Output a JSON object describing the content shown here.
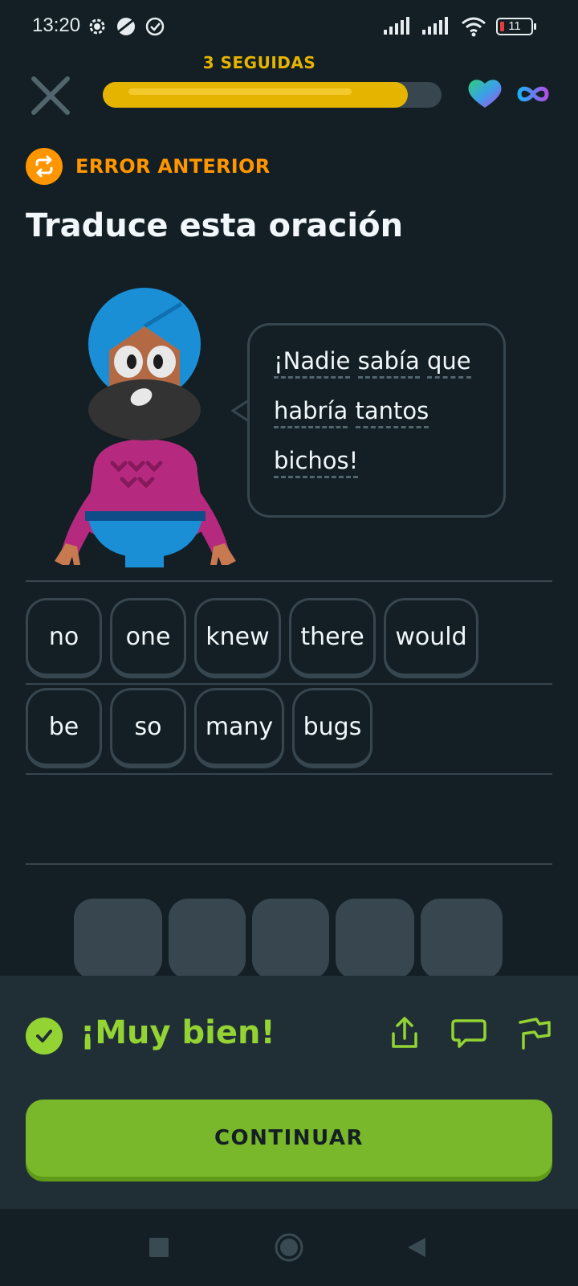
{
  "status_bar": {
    "time": "13:20",
    "battery": "11",
    "icons_left": [
      "settings-gear-icon",
      "planet-icon",
      "check-circle-icon"
    ],
    "icons_right": [
      "signal-icon",
      "signal-icon",
      "wifi-icon",
      "battery-icon"
    ]
  },
  "header": {
    "streak_label": "3 SEGUIDAS",
    "progress": 0.9,
    "close_icon": "close-icon",
    "hearts_icon": "heart-icon",
    "hearts_value": "infinity-icon"
  },
  "prior_error": {
    "label": "ERROR ANTERIOR",
    "icon": "repeat-icon"
  },
  "exercise": {
    "title": "Traduce esta oración",
    "sentence_lines": [
      [
        "¡Nadie",
        "sabía",
        "que"
      ],
      [
        "habría",
        "tantos"
      ],
      [
        "bichos!"
      ]
    ]
  },
  "answer_chips": {
    "row1": [
      "no",
      "one",
      "knew",
      "there",
      "would"
    ],
    "row2": [
      "be",
      "so",
      "many",
      "bugs"
    ]
  },
  "word_bank_slots": 5,
  "feedback": {
    "title": "¡Muy bien!",
    "check_icon": "check-circle-icon",
    "actions": [
      "share-icon",
      "comment-icon",
      "report-flag-icon"
    ],
    "continue_label": "CONTINUAR"
  },
  "nav_bar": {
    "buttons": [
      "recents-square-icon",
      "home-circle-icon",
      "back-triangle-icon"
    ]
  },
  "colors": {
    "background": "#131f24",
    "accent_green": "#93d333",
    "button_green": "#79b82a",
    "streak_yellow": "#e5b400",
    "warning_orange": "#ff9600",
    "border": "#37464f"
  }
}
